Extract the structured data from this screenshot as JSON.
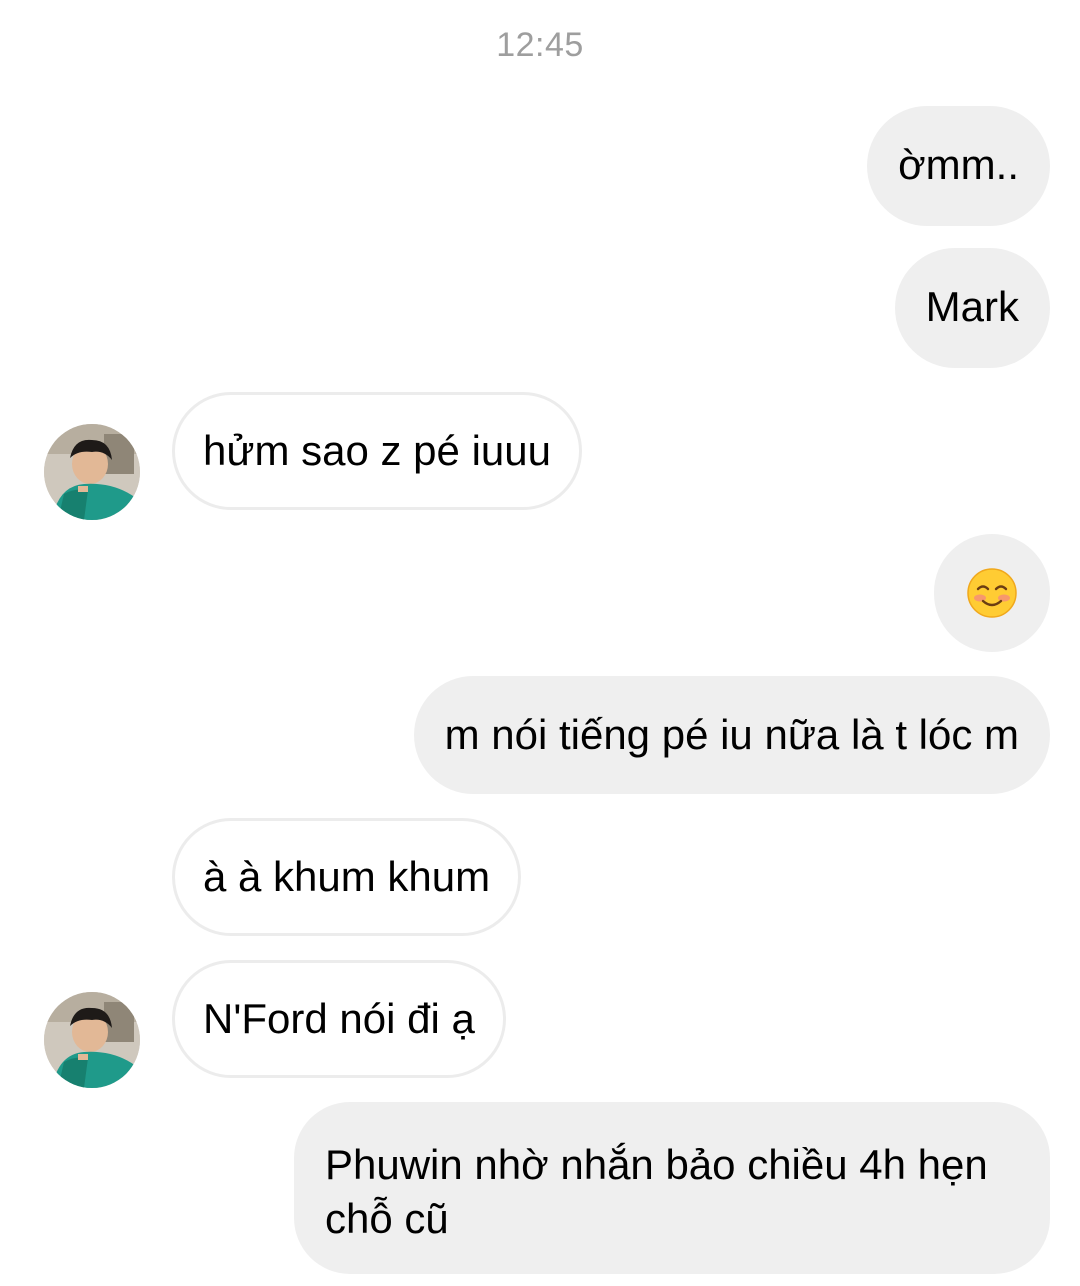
{
  "thread": {
    "timestamp": "12:45",
    "messages": [
      {
        "id": "m1",
        "direction": "outgoing",
        "text": "ờmm.."
      },
      {
        "id": "m2",
        "direction": "outgoing",
        "text": "Mark"
      },
      {
        "id": "m3",
        "direction": "incoming",
        "text": "hửm sao z pé iuuu",
        "avatar": true
      },
      {
        "id": "m4",
        "direction": "outgoing",
        "emoji": "smiling-face-with-blush-emoji"
      },
      {
        "id": "m5",
        "direction": "outgoing",
        "text": "m nói tiếng pé iu nữa là t lóc m"
      },
      {
        "id": "m6",
        "direction": "incoming",
        "text": "à à khum khum",
        "avatar": false
      },
      {
        "id": "m7",
        "direction": "incoming",
        "text": "N'Ford nói đi ạ",
        "avatar": true
      },
      {
        "id": "m8",
        "direction": "outgoing",
        "text": "Phuwin nhờ nhắn bảo chiều 4h hẹn chỗ cũ"
      }
    ]
  },
  "colors": {
    "outgoing_bubble": "#efefef",
    "incoming_border": "#ececec",
    "timestamp_text": "#9e9e9e"
  }
}
